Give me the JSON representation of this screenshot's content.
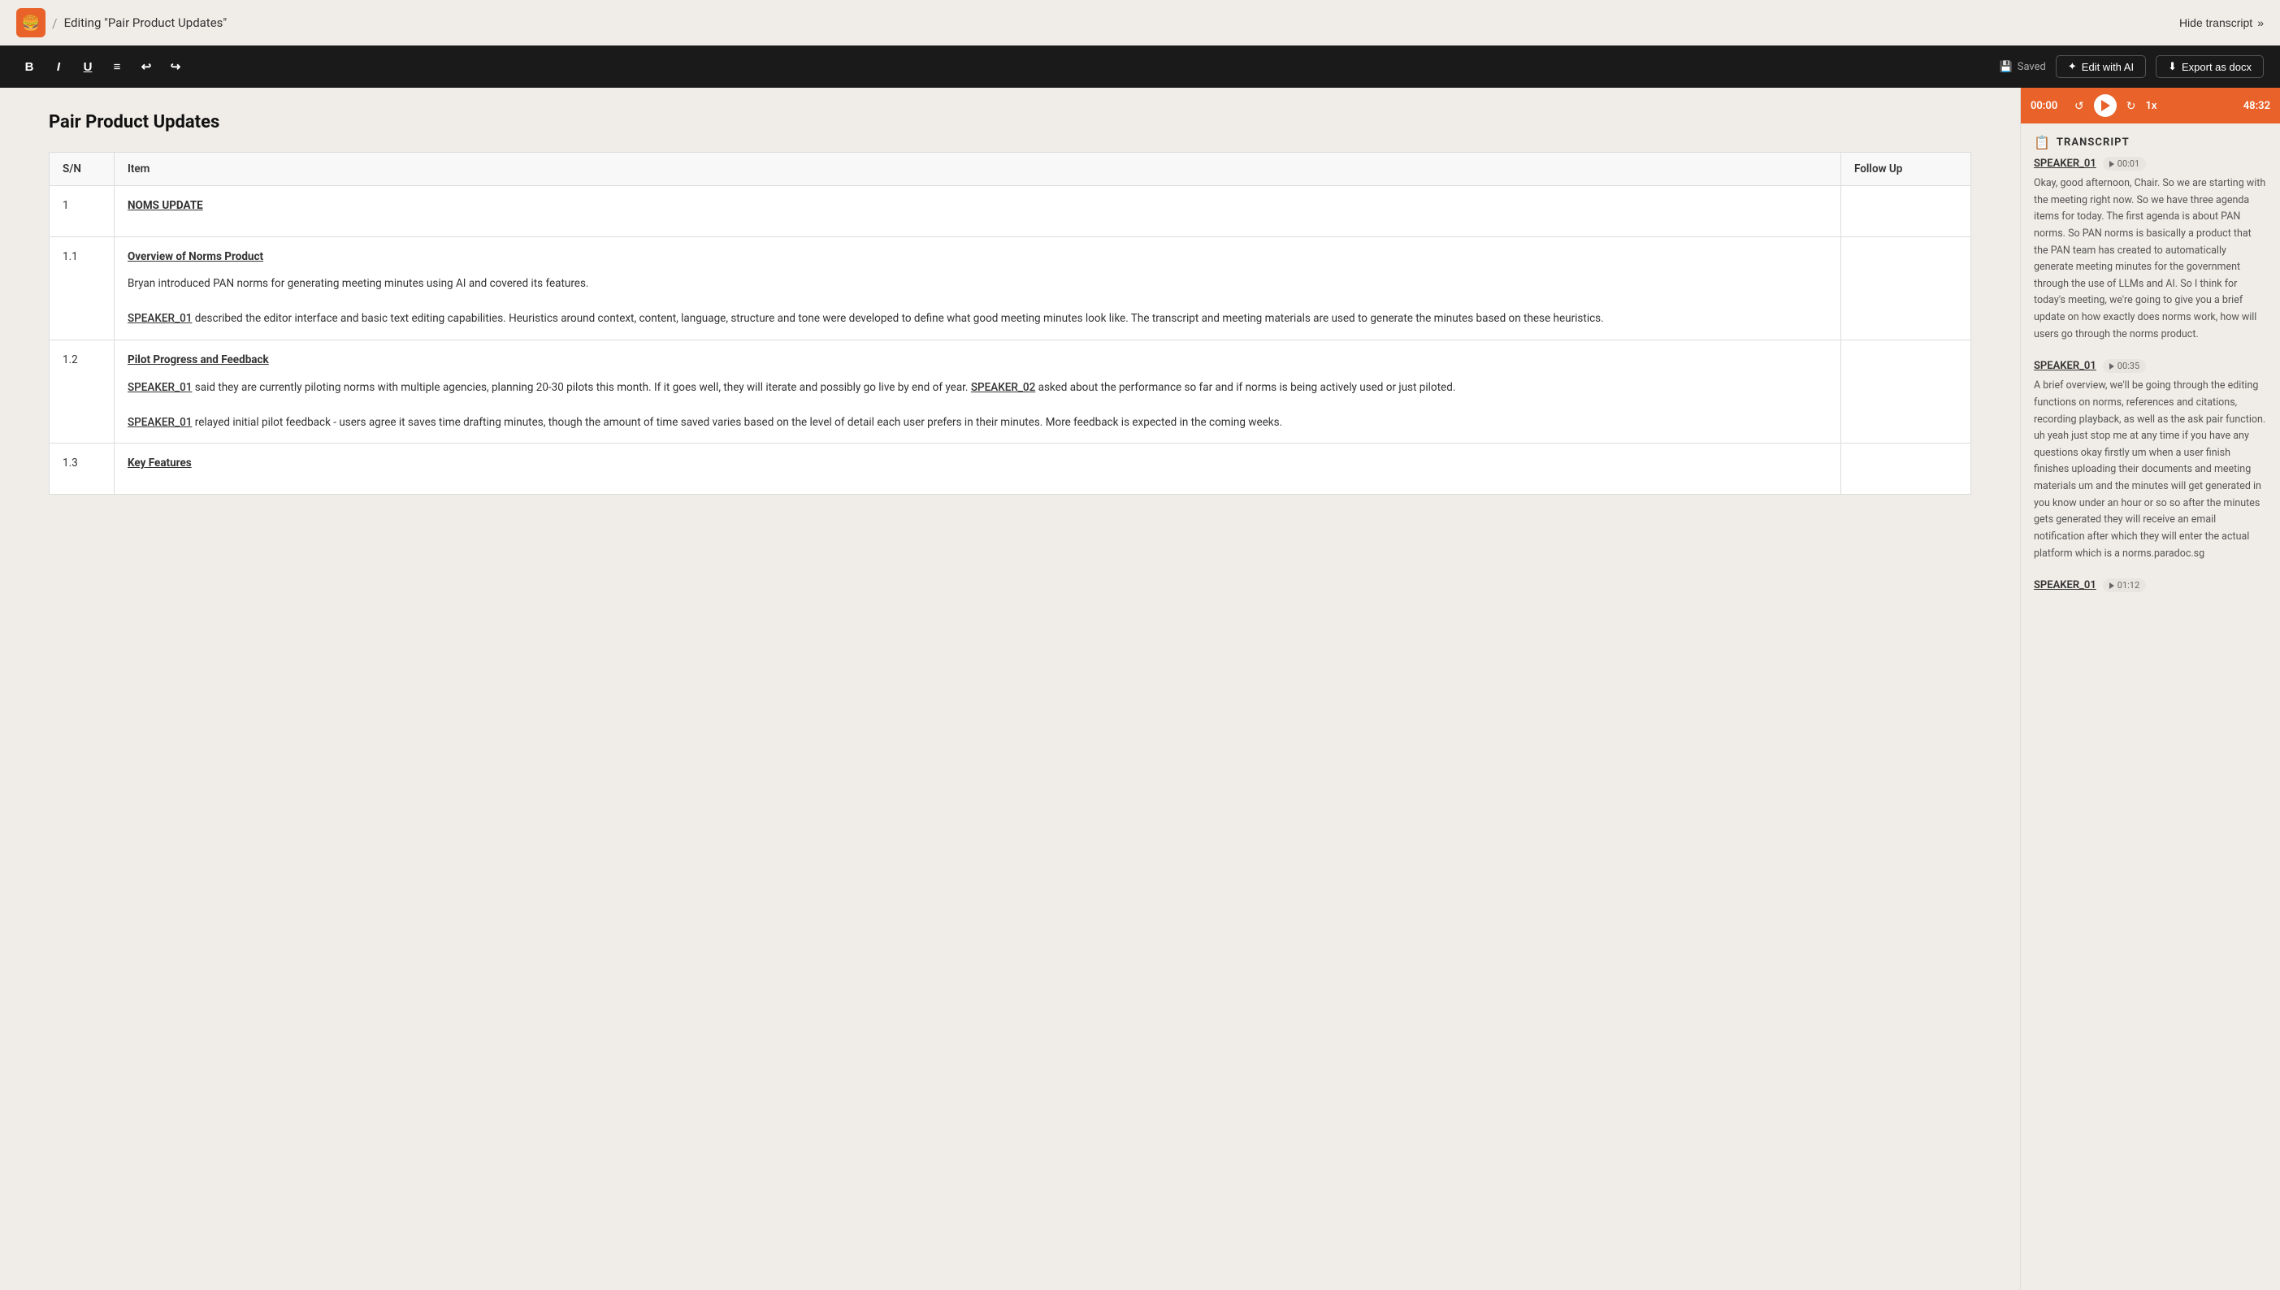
{
  "nav": {
    "logo_emoji": "🍔",
    "breadcrumb_sep": "/",
    "doc_title": "Editing \"Pair Product Updates\"",
    "hide_transcript_label": "Hide transcript",
    "hide_transcript_icon": "»"
  },
  "toolbar": {
    "bold_label": "B",
    "italic_label": "I",
    "underline_label": "U",
    "list_label": "≡",
    "undo_label": "↩",
    "redo_label": "↪",
    "saved_icon": "💾",
    "saved_label": "Saved",
    "edit_ai_icon": "✦",
    "edit_ai_label": "Edit with AI",
    "export_icon": "⬇",
    "export_label": "Export as docx"
  },
  "document": {
    "title": "Pair Product Updates",
    "table": {
      "headers": [
        "S/N",
        "Item",
        "Follow Up"
      ],
      "rows": [
        {
          "sn": "1",
          "item_title": "NOMS UPDATE",
          "item_body": "",
          "follow_up": ""
        },
        {
          "sn": "1.1",
          "item_title": "Overview of Norms Product",
          "item_body": "Bryan introduced PAN norms for generating meeting minutes using AI and covered its features.\n\nSPEAKER_01 described the editor interface and basic text editing capabilities. Heuristics around context, content, language, structure and tone were developed to define what good meeting minutes look like. The transcript and meeting materials are used to generate the minutes based on these heuristics.",
          "follow_up": ""
        },
        {
          "sn": "1.2",
          "item_title": "Pilot Progress and Feedback",
          "item_body": "SPEAKER_01 said they are currently piloting norms with multiple agencies, planning 20-30 pilots this month. If it goes well, they will iterate and possibly go live by end of year. SPEAKER_02 asked about the performance so far and if norms is being actively used or just piloted.\n\nSPEAKER_01 relayed initial pilot feedback - users agree it saves time drafting minutes, though the amount of time saved varies based on the level of detail each user prefers in their minutes. More feedback is expected in the coming weeks.",
          "follow_up": ""
        },
        {
          "sn": "1.3",
          "item_title": "Key Features",
          "item_body": "",
          "follow_up": ""
        }
      ]
    }
  },
  "player": {
    "current_time": "00:00",
    "total_time": "48:32",
    "speed": "1x",
    "is_playing": false
  },
  "transcript": {
    "title": "TRANSCRIPT",
    "segments": [
      {
        "speaker": "SPEAKER_01",
        "timestamp": "00:01",
        "text": "Okay, good afternoon, Chair. So we are starting with the meeting right now. So we have three agenda items for today. The first agenda is about PAN norms. So PAN norms is basically a product that the PAN team has created to automatically generate meeting minutes for the government through the use of LLMs and AI. So I think for today's meeting, we're going to give you a brief update on how exactly does norms work, how will users go through the norms product."
      },
      {
        "speaker": "SPEAKER_01",
        "timestamp": "00:35",
        "text": "A brief overview, we'll be going through the editing functions on norms, references and citations, recording playback, as well as the ask pair function. uh yeah just stop me at any time if you have any questions okay firstly um when a user finish finishes uploading their documents and meeting materials um and the minutes will get generated in you know under an hour or so so after the minutes gets generated they will receive an email notification after which they will enter the actual platform which is a norms.paradoc.sg"
      },
      {
        "speaker": "SPEAKER_01",
        "timestamp": "01:12",
        "text": ""
      }
    ]
  }
}
